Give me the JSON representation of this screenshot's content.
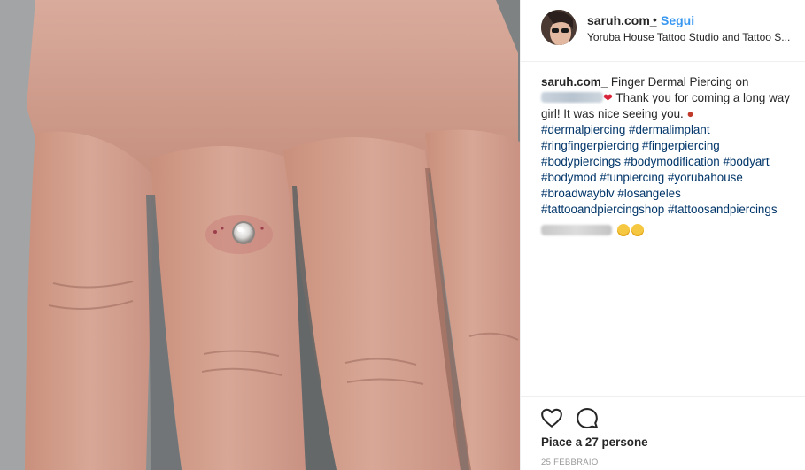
{
  "header": {
    "username": "saruh.com_",
    "separator": "•",
    "follow_label": "Segui",
    "location": "Yoruba House Tattoo Studio and Tattoo S..."
  },
  "caption": {
    "username": "saruh.com_",
    "text_start": "Finger Dermal Piercing on",
    "text_after_tag": "Thank you for coming a long way girl! It was nice seeing you.",
    "hashtags_lines": [
      "#dermalpiercing #dermalimplant",
      "#ringfingerpiercing #fingerpiercing",
      "#bodypiercings #bodymodification #bodyart",
      "#bodymod #funpiercing #yorubahouse",
      "#broadwayblv #losangeles",
      "#tattooandpiercingshop #tattoosandpiercings"
    ]
  },
  "icons": {
    "like": "heart-outline-icon",
    "comment": "speech-bubble-icon",
    "heart_emoji": "red-heart-emoji",
    "girl_emoji": "dancer-emoji"
  },
  "likes_label": "Piace a 27 persone",
  "date_label": "25 FEBBRAIO",
  "colors": {
    "link": "#3897f0",
    "hashtag": "#003569",
    "muted": "#999999"
  }
}
